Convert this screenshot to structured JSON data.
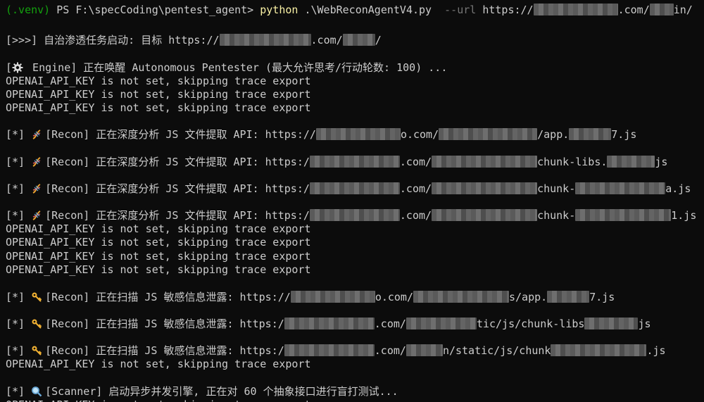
{
  "prompt": {
    "venv": "(.venv)",
    "ps": " PS F:\\specCoding\\pentest_agent> ",
    "command": "python",
    "script": " .\\WebReconAgentV4.py ",
    "flag": " --url",
    "url_start": " https://",
    "url_mid": ".com/",
    "url_end": "in/"
  },
  "mission": {
    "prefix": "[>>>] 自治渗透任务启动: 目标 https://",
    "mid": ".com/",
    "end": "/"
  },
  "engine": {
    "open": "[",
    "icon": "gear-icon",
    "text": " Engine] 正在唤醒 Autonomous Pentester (最大允许思考/行动轮数: 100) ..."
  },
  "openai_warning": "OPENAI_API_KEY is not set, skipping trace export",
  "recon_js": [
    {
      "prefix": "[*] ",
      "icon": "dna-icon",
      "label": "[Recon] 正在深度分析 JS 文件提取 API: https://",
      "mid": "o.com/",
      "tail_a": "/app.",
      "tail_b": "7.js"
    },
    {
      "prefix": "[*] ",
      "icon": "dna-icon",
      "label": "[Recon] 正在深度分析 JS 文件提取 API: https:/",
      "mid": ".com/",
      "tail_a": "chunk-libs.",
      "tail_b": "js"
    },
    {
      "prefix": "[*] ",
      "icon": "dna-icon",
      "label": "[Recon] 正在深度分析 JS 文件提取 API: https:/",
      "mid": ".com/",
      "tail_a": "chunk-",
      "tail_b": "a.js"
    },
    {
      "prefix": "[*] ",
      "icon": "dna-icon",
      "label": "[Recon] 正在深度分析 JS 文件提取 API: https:/",
      "mid": ".com/",
      "tail_a": "chunk-",
      "tail_b": "1.js"
    }
  ],
  "recon_leak": [
    {
      "prefix": "[*] ",
      "icon": "key-icon",
      "label": "[Recon] 正在扫描 JS 敏感信息泄露: https://",
      "mid": "o.com/",
      "tail_a": "s/app.",
      "tail_b": "7.js"
    },
    {
      "prefix": "[*] ",
      "icon": "key-icon",
      "label": "[Recon] 正在扫描 JS 敏感信息泄露: https:/",
      "mid": ".com/",
      "tail_a": "tic/js/chunk-libs",
      "tail_b": "js"
    },
    {
      "prefix": "[*] ",
      "icon": "key-icon",
      "label": "[Recon] 正在扫描 JS 敏感信息泄露: https:/",
      "mid": ".com/",
      "tail_a": "n/static/js/chunk",
      "tail_b": ".js"
    }
  ],
  "scanner": {
    "prefix": "[*] ",
    "icon": "magnifier-icon",
    "label": "[Scanner] 启动异步并发引擎, 正在对 60 个抽象接口进行盲打测试..."
  }
}
